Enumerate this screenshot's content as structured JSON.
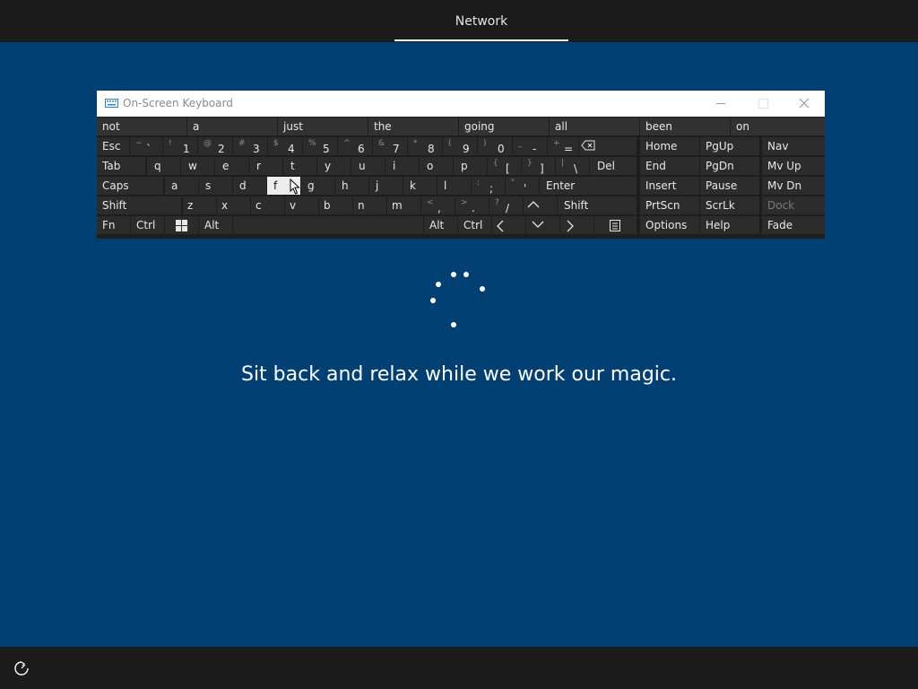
{
  "header": {
    "tab": "Network"
  },
  "osk": {
    "title": "On-Screen Keyboard",
    "predictions": [
      "not",
      "a",
      "just",
      "the",
      "going",
      "all",
      "been",
      "on"
    ],
    "row1": [
      {
        "label": "Esc"
      },
      {
        "shift": "~",
        "main": "`"
      },
      {
        "shift": "!",
        "main": "1"
      },
      {
        "shift": "@",
        "main": "2"
      },
      {
        "shift": "#",
        "main": "3"
      },
      {
        "shift": "$",
        "main": "4"
      },
      {
        "shift": "%",
        "main": "5"
      },
      {
        "shift": "^",
        "main": "6"
      },
      {
        "shift": "&",
        "main": "7"
      },
      {
        "shift": "*",
        "main": "8"
      },
      {
        "shift": "(",
        "main": "9"
      },
      {
        "shift": ")",
        "main": "0"
      },
      {
        "shift": "_",
        "main": "-"
      },
      {
        "shift": "+",
        "main": "="
      }
    ],
    "row2": {
      "tab": "Tab",
      "letters": [
        "q",
        "w",
        "e",
        "r",
        "t",
        "y",
        "u",
        "i",
        "o",
        "p"
      ],
      "brackets": [
        {
          "shift": "{",
          "main": "["
        },
        {
          "shift": "}",
          "main": "]"
        },
        {
          "shift": "|",
          "main": "\\"
        }
      ],
      "del": "Del"
    },
    "row3": {
      "caps": "Caps",
      "letters": [
        "a",
        "s",
        "d",
        "f",
        "g",
        "h",
        "j",
        "k",
        "l"
      ],
      "punct": [
        {
          "shift": ":",
          "main": ";"
        },
        {
          "shift": "\"",
          "main": "'"
        }
      ],
      "enter": "Enter"
    },
    "row4": {
      "shift": "Shift",
      "letters": [
        "z",
        "x",
        "c",
        "v",
        "b",
        "n",
        "m"
      ],
      "punct": [
        {
          "shift": "<",
          "main": ","
        },
        {
          "shift": ">",
          "main": "."
        },
        {
          "shift": "?",
          "main": "/"
        }
      ],
      "shift_right": "Shift"
    },
    "row5": {
      "fn": "Fn",
      "ctrl": "Ctrl",
      "alt": "Alt",
      "alt_right": "Alt",
      "ctrl_right": "Ctrl"
    },
    "nav": {
      "home": "Home",
      "pgup": "PgUp",
      "nav": "Nav",
      "end": "End",
      "pgdn": "PgDn",
      "mvup": "Mv Up",
      "insert": "Insert",
      "pause": "Pause",
      "mvdn": "Mv Dn",
      "prtscn": "PrtScn",
      "scrlk": "ScrLk",
      "dock": "Dock",
      "options": "Options",
      "help": "Help",
      "fade": "Fade"
    },
    "highlighted_key": "f",
    "colors": {
      "key": "#2c2c2c",
      "highlight": "#ededed",
      "background": "#024073"
    }
  },
  "main": {
    "message": "Sit back and relax while we work our magic."
  },
  "icons": {
    "accessibility": "ease-of-access-icon",
    "keyboard": "keyboard-icon",
    "windows": "windows-logo-icon"
  }
}
